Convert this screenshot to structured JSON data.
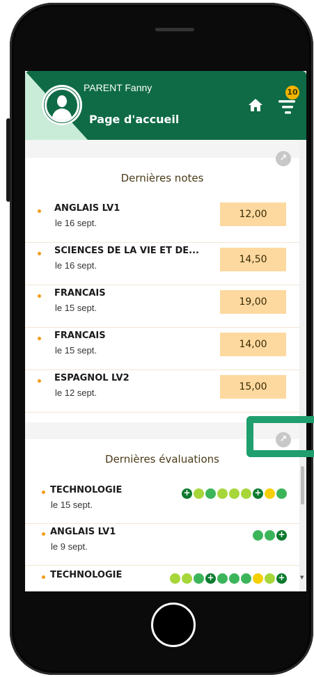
{
  "header": {
    "user_name": "PARENT Fanny",
    "page_title": "Page d'accueil",
    "notification_count": "10"
  },
  "notes_card": {
    "title": "Dernières notes",
    "items": [
      {
        "subject": "ANGLAIS LV1",
        "date": "le 16 sept.",
        "grade": "12,00"
      },
      {
        "subject": "SCIENCES DE LA VIE ET DE...",
        "date": "le 16 sept.",
        "grade": "14,50"
      },
      {
        "subject": "FRANCAIS",
        "date": "le 15 sept.",
        "grade": "19,00"
      },
      {
        "subject": "FRANCAIS",
        "date": "le 15 sept.",
        "grade": "14,00"
      },
      {
        "subject": "ESPAGNOL LV2",
        "date": "le 12 sept.",
        "grade": "15,00"
      }
    ]
  },
  "evals_card": {
    "title": "Dernières évaluations",
    "items": [
      {
        "subject": "TECHNOLOGIE",
        "date": "le 15 sept.",
        "dots": [
          "dg+",
          "lg",
          "mg",
          "lg",
          "lg",
          "lg",
          "dg+",
          "y",
          "mg"
        ]
      },
      {
        "subject": "ANGLAIS LV1",
        "date": "le 9 sept.",
        "dots": [
          "mg",
          "mg",
          "dg+"
        ]
      },
      {
        "subject": "TECHNOLOGIE",
        "date": "",
        "dots": [
          "lg",
          "lg",
          "mg",
          "dg+",
          "mg",
          "mg",
          "mg",
          "y",
          "lg",
          "dg+"
        ]
      }
    ]
  },
  "colors": {
    "header_green": "#0e6b45",
    "dark_green": "#0a7a2e",
    "medium_green": "#3cb55a",
    "light_green": "#a6d63a",
    "yellow": "#f5cf00",
    "grade_bg": "#fdd9a0",
    "highlight": "#1f9e6e"
  },
  "icons": {
    "home": "home-icon",
    "menu": "menu-icon",
    "link": "arrow-up-right-icon",
    "avatar": "user-icon"
  }
}
